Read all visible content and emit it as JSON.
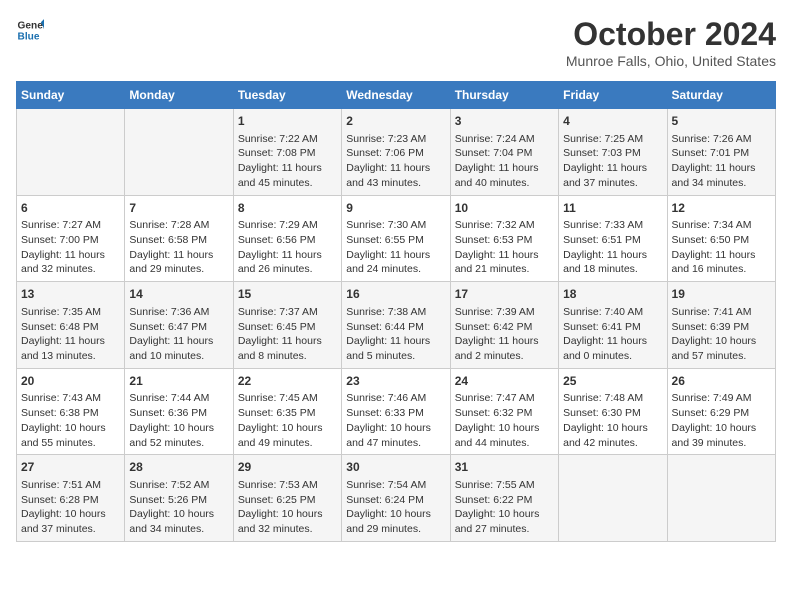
{
  "header": {
    "logo_line1": "General",
    "logo_line2": "Blue",
    "title": "October 2024",
    "subtitle": "Munroe Falls, Ohio, United States"
  },
  "days_of_week": [
    "Sunday",
    "Monday",
    "Tuesday",
    "Wednesday",
    "Thursday",
    "Friday",
    "Saturday"
  ],
  "weeks": [
    [
      {
        "day": "",
        "info": ""
      },
      {
        "day": "",
        "info": ""
      },
      {
        "day": "1",
        "sunrise": "Sunrise: 7:22 AM",
        "sunset": "Sunset: 7:08 PM",
        "daylight": "Daylight: 11 hours and 45 minutes."
      },
      {
        "day": "2",
        "sunrise": "Sunrise: 7:23 AM",
        "sunset": "Sunset: 7:06 PM",
        "daylight": "Daylight: 11 hours and 43 minutes."
      },
      {
        "day": "3",
        "sunrise": "Sunrise: 7:24 AM",
        "sunset": "Sunset: 7:04 PM",
        "daylight": "Daylight: 11 hours and 40 minutes."
      },
      {
        "day": "4",
        "sunrise": "Sunrise: 7:25 AM",
        "sunset": "Sunset: 7:03 PM",
        "daylight": "Daylight: 11 hours and 37 minutes."
      },
      {
        "day": "5",
        "sunrise": "Sunrise: 7:26 AM",
        "sunset": "Sunset: 7:01 PM",
        "daylight": "Daylight: 11 hours and 34 minutes."
      }
    ],
    [
      {
        "day": "6",
        "sunrise": "Sunrise: 7:27 AM",
        "sunset": "Sunset: 7:00 PM",
        "daylight": "Daylight: 11 hours and 32 minutes."
      },
      {
        "day": "7",
        "sunrise": "Sunrise: 7:28 AM",
        "sunset": "Sunset: 6:58 PM",
        "daylight": "Daylight: 11 hours and 29 minutes."
      },
      {
        "day": "8",
        "sunrise": "Sunrise: 7:29 AM",
        "sunset": "Sunset: 6:56 PM",
        "daylight": "Daylight: 11 hours and 26 minutes."
      },
      {
        "day": "9",
        "sunrise": "Sunrise: 7:30 AM",
        "sunset": "Sunset: 6:55 PM",
        "daylight": "Daylight: 11 hours and 24 minutes."
      },
      {
        "day": "10",
        "sunrise": "Sunrise: 7:32 AM",
        "sunset": "Sunset: 6:53 PM",
        "daylight": "Daylight: 11 hours and 21 minutes."
      },
      {
        "day": "11",
        "sunrise": "Sunrise: 7:33 AM",
        "sunset": "Sunset: 6:51 PM",
        "daylight": "Daylight: 11 hours and 18 minutes."
      },
      {
        "day": "12",
        "sunrise": "Sunrise: 7:34 AM",
        "sunset": "Sunset: 6:50 PM",
        "daylight": "Daylight: 11 hours and 16 minutes."
      }
    ],
    [
      {
        "day": "13",
        "sunrise": "Sunrise: 7:35 AM",
        "sunset": "Sunset: 6:48 PM",
        "daylight": "Daylight: 11 hours and 13 minutes."
      },
      {
        "day": "14",
        "sunrise": "Sunrise: 7:36 AM",
        "sunset": "Sunset: 6:47 PM",
        "daylight": "Daylight: 11 hours and 10 minutes."
      },
      {
        "day": "15",
        "sunrise": "Sunrise: 7:37 AM",
        "sunset": "Sunset: 6:45 PM",
        "daylight": "Daylight: 11 hours and 8 minutes."
      },
      {
        "day": "16",
        "sunrise": "Sunrise: 7:38 AM",
        "sunset": "Sunset: 6:44 PM",
        "daylight": "Daylight: 11 hours and 5 minutes."
      },
      {
        "day": "17",
        "sunrise": "Sunrise: 7:39 AM",
        "sunset": "Sunset: 6:42 PM",
        "daylight": "Daylight: 11 hours and 2 minutes."
      },
      {
        "day": "18",
        "sunrise": "Sunrise: 7:40 AM",
        "sunset": "Sunset: 6:41 PM",
        "daylight": "Daylight: 11 hours and 0 minutes."
      },
      {
        "day": "19",
        "sunrise": "Sunrise: 7:41 AM",
        "sunset": "Sunset: 6:39 PM",
        "daylight": "Daylight: 10 hours and 57 minutes."
      }
    ],
    [
      {
        "day": "20",
        "sunrise": "Sunrise: 7:43 AM",
        "sunset": "Sunset: 6:38 PM",
        "daylight": "Daylight: 10 hours and 55 minutes."
      },
      {
        "day": "21",
        "sunrise": "Sunrise: 7:44 AM",
        "sunset": "Sunset: 6:36 PM",
        "daylight": "Daylight: 10 hours and 52 minutes."
      },
      {
        "day": "22",
        "sunrise": "Sunrise: 7:45 AM",
        "sunset": "Sunset: 6:35 PM",
        "daylight": "Daylight: 10 hours and 49 minutes."
      },
      {
        "day": "23",
        "sunrise": "Sunrise: 7:46 AM",
        "sunset": "Sunset: 6:33 PM",
        "daylight": "Daylight: 10 hours and 47 minutes."
      },
      {
        "day": "24",
        "sunrise": "Sunrise: 7:47 AM",
        "sunset": "Sunset: 6:32 PM",
        "daylight": "Daylight: 10 hours and 44 minutes."
      },
      {
        "day": "25",
        "sunrise": "Sunrise: 7:48 AM",
        "sunset": "Sunset: 6:30 PM",
        "daylight": "Daylight: 10 hours and 42 minutes."
      },
      {
        "day": "26",
        "sunrise": "Sunrise: 7:49 AM",
        "sunset": "Sunset: 6:29 PM",
        "daylight": "Daylight: 10 hours and 39 minutes."
      }
    ],
    [
      {
        "day": "27",
        "sunrise": "Sunrise: 7:51 AM",
        "sunset": "Sunset: 6:28 PM",
        "daylight": "Daylight: 10 hours and 37 minutes."
      },
      {
        "day": "28",
        "sunrise": "Sunrise: 7:52 AM",
        "sunset": "Sunset: 5:26 PM",
        "daylight": "Daylight: 10 hours and 34 minutes."
      },
      {
        "day": "29",
        "sunrise": "Sunrise: 7:53 AM",
        "sunset": "Sunset: 6:25 PM",
        "daylight": "Daylight: 10 hours and 32 minutes."
      },
      {
        "day": "30",
        "sunrise": "Sunrise: 7:54 AM",
        "sunset": "Sunset: 6:24 PM",
        "daylight": "Daylight: 10 hours and 29 minutes."
      },
      {
        "day": "31",
        "sunrise": "Sunrise: 7:55 AM",
        "sunset": "Sunset: 6:22 PM",
        "daylight": "Daylight: 10 hours and 27 minutes."
      },
      {
        "day": "",
        "info": ""
      },
      {
        "day": "",
        "info": ""
      }
    ]
  ]
}
